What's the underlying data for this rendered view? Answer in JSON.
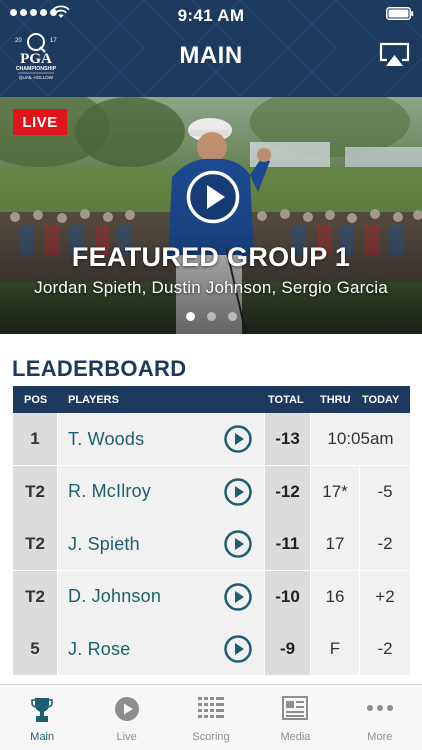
{
  "status_bar": {
    "time": "9:41 AM"
  },
  "header": {
    "title": "MAIN",
    "logo_icon": "pga-championship-logo",
    "airplay_icon": "airplay-icon"
  },
  "hero": {
    "live_label": "LIVE",
    "title": "FEATURED GROUP 1",
    "subtitle": "Jordan Spieth, Dustin Johnson, Sergio Garcia",
    "page_count": 3,
    "active_page": 1
  },
  "leaderboard": {
    "title": "LEADERBOARD",
    "columns": {
      "pos": "POS",
      "players": "PLAYERS",
      "total": "TOTAL",
      "thru": "THRU",
      "today": "TODAY"
    },
    "rows": [
      {
        "pos": "1",
        "player": "T. Woods",
        "total": "-13",
        "thru": "10:05am",
        "today": ""
      },
      {
        "pos": "T2",
        "player": "R. McIlroy",
        "total": "-12",
        "thru": "17*",
        "today": "-5"
      },
      {
        "pos": "T2",
        "player": "J. Spieth",
        "total": "-11",
        "thru": "17",
        "today": "-2"
      },
      {
        "pos": "T2",
        "player": "D. Johnson",
        "total": "-10",
        "thru": "16",
        "today": "+2"
      },
      {
        "pos": "5",
        "player": "J. Rose",
        "total": "-9",
        "thru": "F",
        "today": "-2"
      }
    ]
  },
  "tabs": [
    {
      "label": "Main",
      "icon": "trophy-icon",
      "active": true
    },
    {
      "label": "Live",
      "icon": "play-circle-icon",
      "active": false
    },
    {
      "label": "Scoring",
      "icon": "scoring-grid-icon",
      "active": false
    },
    {
      "label": "Media",
      "icon": "newspaper-icon",
      "active": false
    },
    {
      "label": "More",
      "icon": "more-dots-icon",
      "active": false
    }
  ],
  "colors": {
    "brand_navy": "#1b3a5e",
    "accent_teal": "#1d5f70",
    "live_red": "#e0141b"
  }
}
